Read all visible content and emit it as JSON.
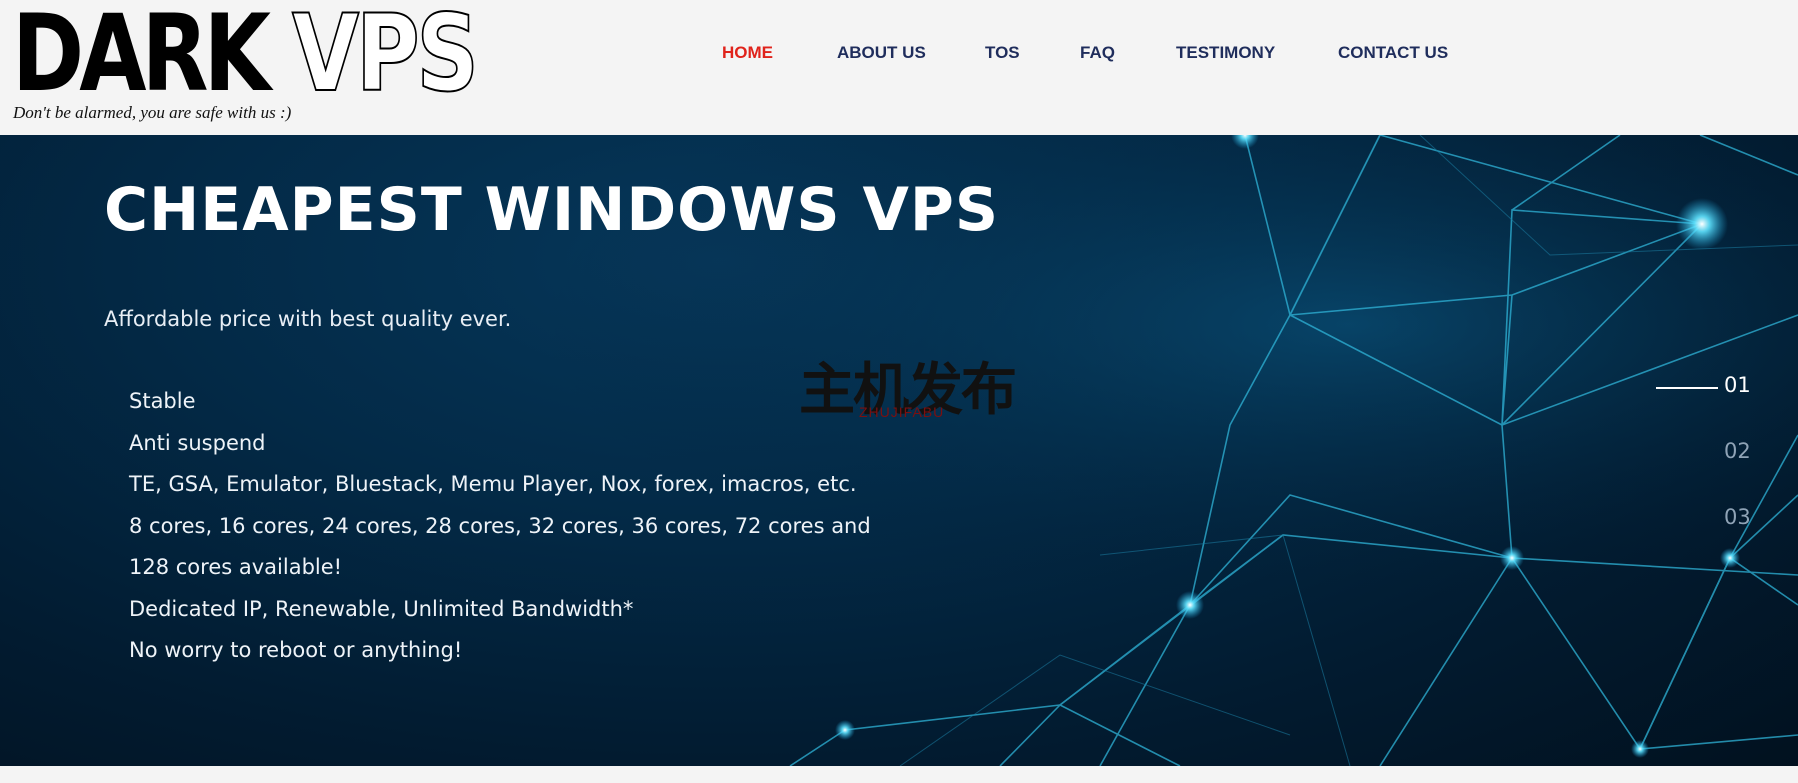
{
  "brand": {
    "logo_dark": "DARK",
    "logo_vps": "VPS",
    "tagline": "Don't be alarmed, you are safe with us :)"
  },
  "nav": {
    "items": [
      {
        "label": "HOME",
        "active": true
      },
      {
        "label": "ABOUT US",
        "active": false
      },
      {
        "label": "TOS",
        "active": false
      },
      {
        "label": "FAQ",
        "active": false
      },
      {
        "label": "TESTIMONY",
        "active": false
      },
      {
        "label": "CONTACT US",
        "active": false
      }
    ]
  },
  "hero": {
    "title": "CHEAPEST WINDOWS VPS",
    "subtitle": "Affordable price with best quality ever.",
    "features": [
      "Stable",
      "Anti suspend",
      "TE, GSA, Emulator, Bluestack, Memu Player, Nox, forex, imacros, etc.",
      "8 cores, 16 cores, 24 cores, 28 cores, 32 cores, 36 cores, 72 cores and 128 cores available!",
      "Dedicated IP, Renewable, Unlimited Bandwidth*",
      "No worry to reboot or anything!"
    ]
  },
  "watermark": {
    "chinese": "主机发布",
    "english": "ZHUJIFABU"
  },
  "slider": {
    "slides": [
      "01",
      "02",
      "03"
    ],
    "active_index": 0
  },
  "colors": {
    "nav_text": "#1f2d5c",
    "nav_active": "#e0231b",
    "hero_bg": "#032a47",
    "network_lines": "#2fb4d8"
  }
}
